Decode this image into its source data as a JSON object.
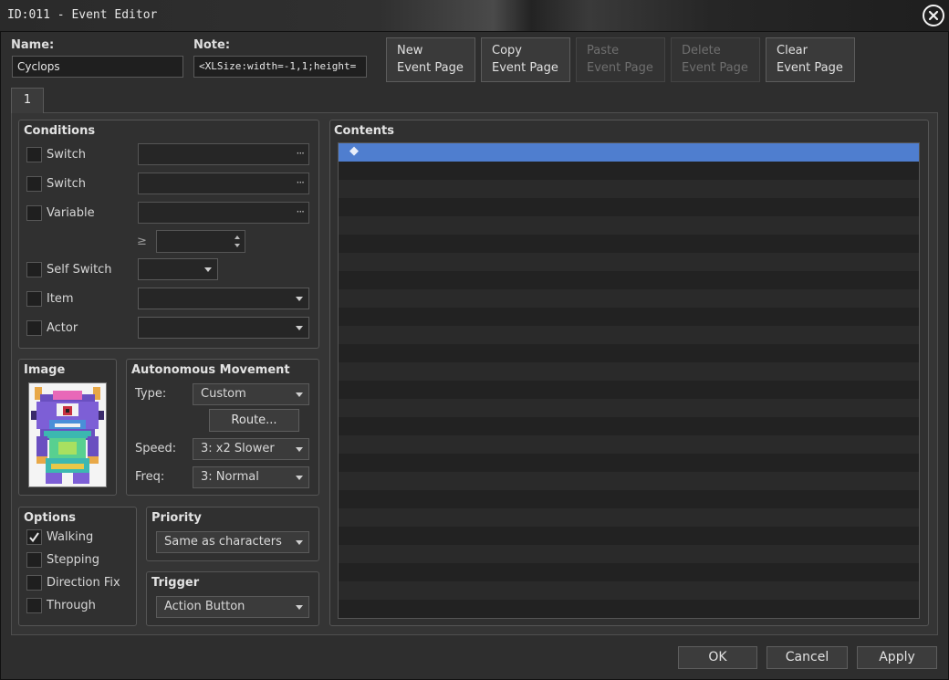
{
  "window": {
    "title": "ID:011 - Event Editor"
  },
  "header": {
    "name_label": "Name:",
    "name_value": "Cyclops",
    "note_label": "Note:",
    "note_value": "<XLSize:width=-1,1;height="
  },
  "toolbar": {
    "new_line1": "New",
    "new_line2": "Event Page",
    "copy_line1": "Copy",
    "copy_line2": "Event Page",
    "paste_line1": "Paste",
    "paste_line2": "Event Page",
    "delete_line1": "Delete",
    "delete_line2": "Event Page",
    "clear_line1": "Clear",
    "clear_line2": "Event Page"
  },
  "tabs": [
    {
      "label": "1"
    }
  ],
  "conditions": {
    "title": "Conditions",
    "switch1_label": "Switch",
    "switch2_label": "Switch",
    "variable_label": "Variable",
    "gte_symbol": "≥",
    "self_switch_label": "Self Switch",
    "item_label": "Item",
    "actor_label": "Actor",
    "ellipsis": "···"
  },
  "image": {
    "title": "Image"
  },
  "movement": {
    "title": "Autonomous Movement",
    "type_label": "Type:",
    "type_value": "Custom",
    "route_button": "Route...",
    "speed_label": "Speed:",
    "speed_value": "3: x2 Slower",
    "freq_label": "Freq:",
    "freq_value": "3: Normal"
  },
  "options": {
    "title": "Options",
    "walking": "Walking",
    "stepping": "Stepping",
    "direction_fix": "Direction Fix",
    "through": "Through"
  },
  "priority": {
    "title": "Priority",
    "value": "Same as characters"
  },
  "trigger": {
    "title": "Trigger",
    "value": "Action Button"
  },
  "contents": {
    "title": "Contents",
    "marker": "◆"
  },
  "footer": {
    "ok": "OK",
    "cancel": "Cancel",
    "apply": "Apply"
  },
  "icons": {
    "close": "close-icon",
    "check": "checkmark-icon",
    "arrow": "dropdown-arrow-icon"
  },
  "colors": {
    "selection": "#4f7ecf",
    "background": "#2e2e2e"
  }
}
